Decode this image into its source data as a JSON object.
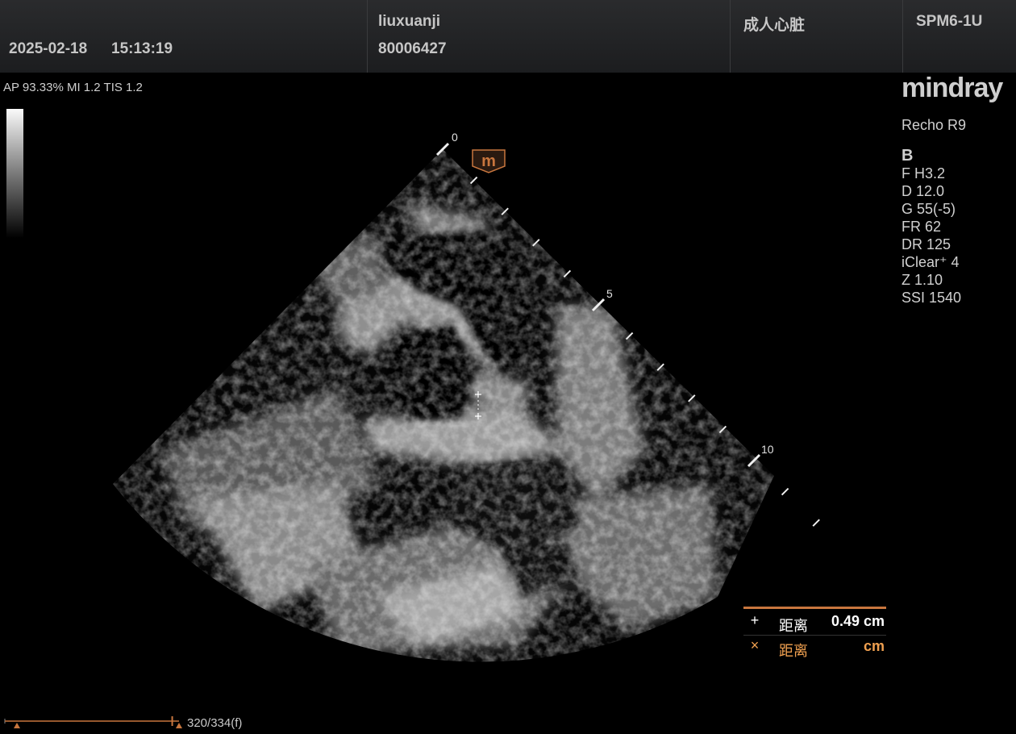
{
  "header": {
    "date": "2025-02-18",
    "time": "15:13:19",
    "operator": "liuxuanji",
    "patient_id": "80006427",
    "exam_type": "成人心脏",
    "probe": "SPM6-1U"
  },
  "acoustic": "AP 93.33%  MI 1.2 TIS 1.2",
  "brand": {
    "logo": "mindray",
    "model": "Recho R9"
  },
  "imaging_params": {
    "mode": "B",
    "items": [
      "F H3.2",
      "D 12.0",
      "G 55(-5)",
      "FR 62",
      "DR 125",
      "iClear⁺ 4",
      "Z 1.10",
      "SSI 1540"
    ]
  },
  "depth_scale": {
    "labels": [
      "0",
      "5",
      "10"
    ]
  },
  "orientation_marker": "m",
  "measurements": [
    {
      "symbol": "+",
      "label": "距离",
      "value": "0.49 cm",
      "color": "#ffffff"
    },
    {
      "symbol": "×",
      "label": "距离",
      "value": "cm",
      "color": "#f0a050"
    }
  ],
  "cine": {
    "frame_text": "320/334(f)",
    "current": 320,
    "total": 334
  },
  "colors": {
    "accent": "#c8763e",
    "measure_highlight": "#f0a050"
  }
}
